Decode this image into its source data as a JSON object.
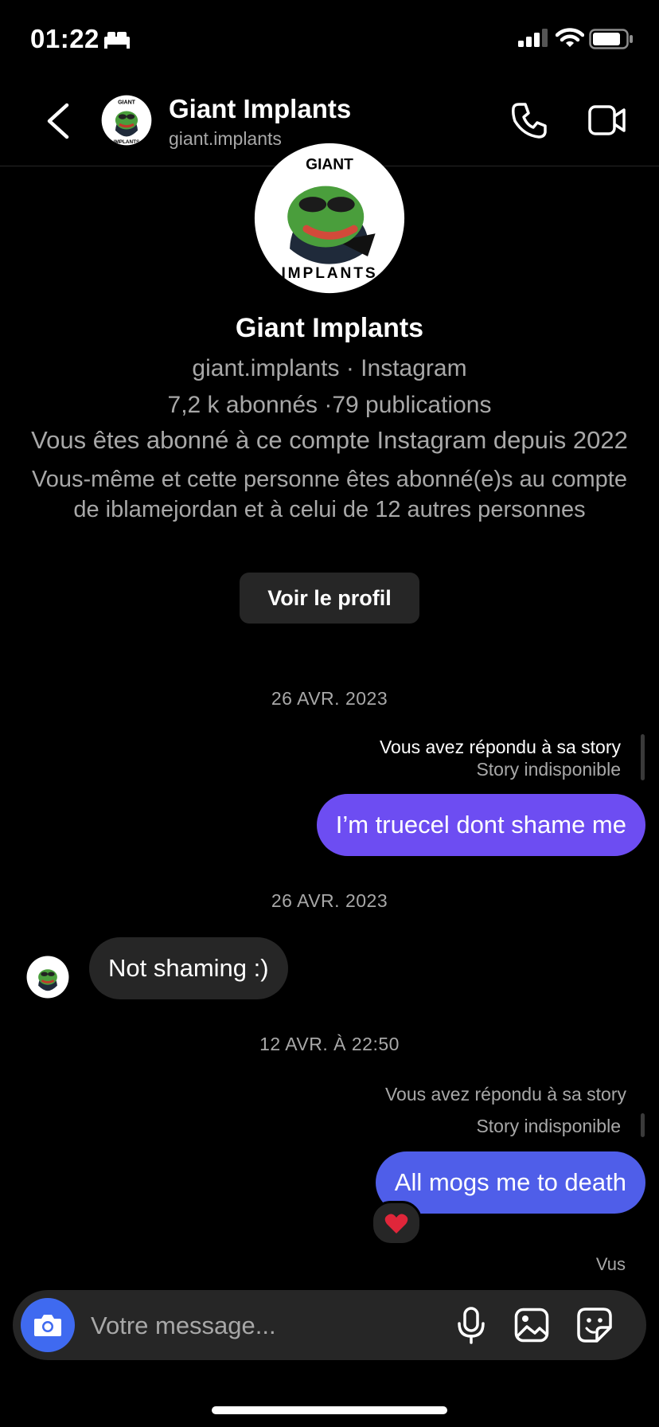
{
  "status_bar": {
    "time": "01:22"
  },
  "header": {
    "name": "Giant Implants",
    "username": "giant.implants"
  },
  "profile": {
    "name": "Giant Implants",
    "handle_line": "giant.implants · Instagram",
    "stats": "7,2 k abonnés ·79 publications",
    "follow_since": "Vous êtes abonné à ce compte Instagram depuis 2022",
    "mutual": "Vous-même et cette personne êtes abonné(e)s au compte de iblamejordan et à celui de 12 autres personnes",
    "button_label": "Voir le profil",
    "logo_text_top": "GIANT",
    "logo_text_bottom": "IMPLANTS"
  },
  "conversation": {
    "date_1": "26 AVR. 2023",
    "reply_note_1": "Vous avez répondu à sa story",
    "story_unavailable_1": "Story indisponible",
    "msg_1": "I’m truecel dont shame me",
    "date_2": "26 AVR. 2023",
    "msg_2": "Not shaming :)",
    "date_3": "12 AVR. À 22:50",
    "reply_note_2": "Vous avez répondu à sa story",
    "story_unavailable_2": "Story indisponible",
    "msg_3": "All mogs me to death",
    "reaction": "❤️",
    "seen": "Vus"
  },
  "composer": {
    "placeholder": "Votre message..."
  },
  "colors": {
    "background": "#000000",
    "sent_bubble_1": "#6d4df2",
    "sent_bubble_2": "#4f5ee9",
    "received_bubble": "#262626",
    "camera_button": "#3f6af0",
    "secondary_text": "#a8a8a8"
  },
  "icons": [
    "bed-icon",
    "signal-icon",
    "wifi-icon",
    "battery-icon",
    "back-arrow-icon",
    "phone-icon",
    "video-camera-icon",
    "camera-icon",
    "microphone-icon",
    "gallery-icon",
    "sticker-icon",
    "heart-icon"
  ]
}
